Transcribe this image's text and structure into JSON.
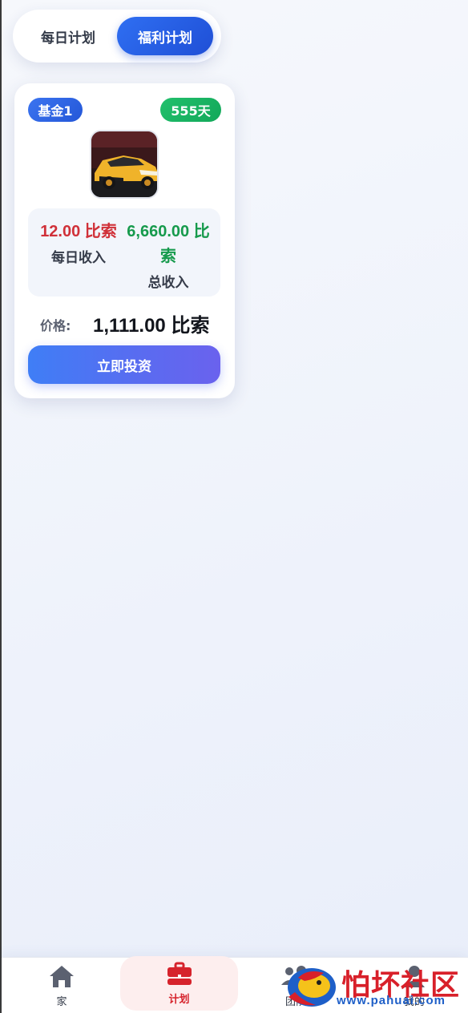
{
  "tabs": [
    {
      "label": "每日计划",
      "active": false
    },
    {
      "label": "福利计划",
      "active": true
    }
  ],
  "product": {
    "badge": "基金1",
    "duration": "555天",
    "daily_income_value": "12.00 比索",
    "daily_income_label": "每日收入",
    "total_income_value": "6,660.00 比索",
    "total_income_label": "总收入",
    "price_label": "价格:",
    "price_value": "1,111.00 比索",
    "invest_button": "立即投资"
  },
  "nav": [
    {
      "label": "家",
      "icon": "home-icon",
      "active": false
    },
    {
      "label": "计划",
      "icon": "briefcase-icon",
      "active": true
    },
    {
      "label": "团队",
      "icon": "team-icon",
      "active": false
    },
    {
      "label": "我的",
      "icon": "profile-icon",
      "active": false
    }
  ],
  "watermark": {
    "text": "怕坏社区",
    "url": "www.pahuai.com"
  },
  "colors": {
    "accent_blue": "#2457d8",
    "badge_green": "#12a85a",
    "income_red": "#d03038",
    "income_green": "#169a4c",
    "nav_active_red": "#d6232c"
  }
}
